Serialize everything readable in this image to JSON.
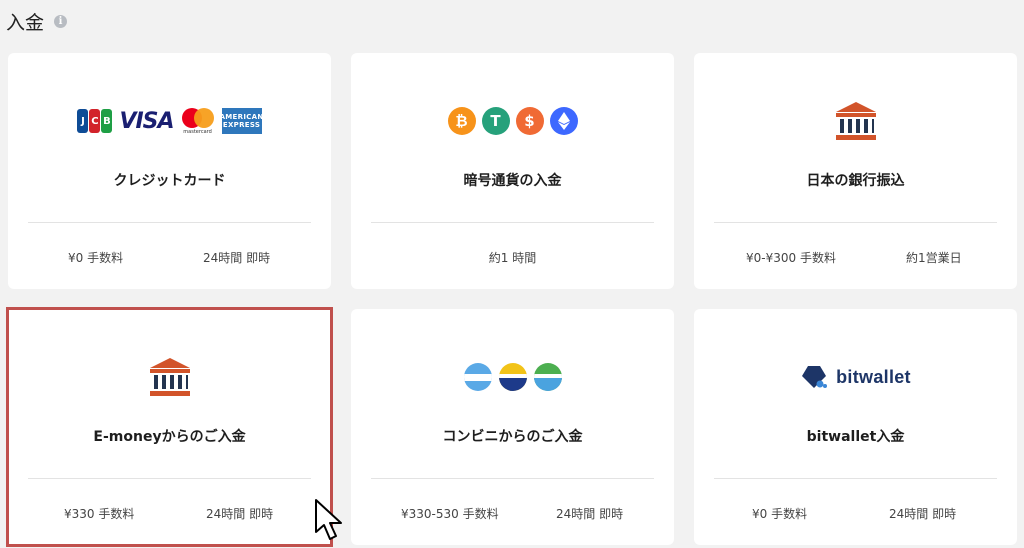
{
  "page": {
    "title": "入金",
    "info_icon": "info-circle-icon"
  },
  "colors": {
    "background": "#f2f2f2",
    "card": "#ffffff",
    "selected_border": "#c0504d",
    "bank_icon": "#d2542a"
  },
  "cards": [
    {
      "title": "クレジットカード",
      "logo": "credit-card-brands",
      "brands": {
        "jcb": "JCB",
        "visa": "VISA",
        "mastercard": "mastercard",
        "amex_line1": "AMERICAN",
        "amex_line2": "EXPRESS"
      },
      "fee": "¥0 手数料",
      "time": "24時間 即時"
    },
    {
      "title": "暗号通貨の入金",
      "logo": "crypto-coins",
      "coins": [
        "bitcoin",
        "tether",
        "usd-coin",
        "ethereum"
      ],
      "time": "約1 時間"
    },
    {
      "title": "日本の銀行振込",
      "logo": "bank-icon",
      "fee": "¥0-¥300 手数料",
      "time": "約1営業日"
    },
    {
      "title": "E-moneyからのご入金",
      "logo": "bank-icon",
      "fee": "¥330 手数料",
      "time": "24時間 即時",
      "selected": true
    },
    {
      "title": "コンビニからのご入金",
      "logo": "convenience-store-icons",
      "fee": "¥330-530 手数料",
      "time": "24時間 即時"
    },
    {
      "title": "bitwallet入金",
      "logo": "bitwallet-logo",
      "logo_text": "bitwallet",
      "fee": "¥0 手数料",
      "time": "24時間 即時"
    }
  ]
}
